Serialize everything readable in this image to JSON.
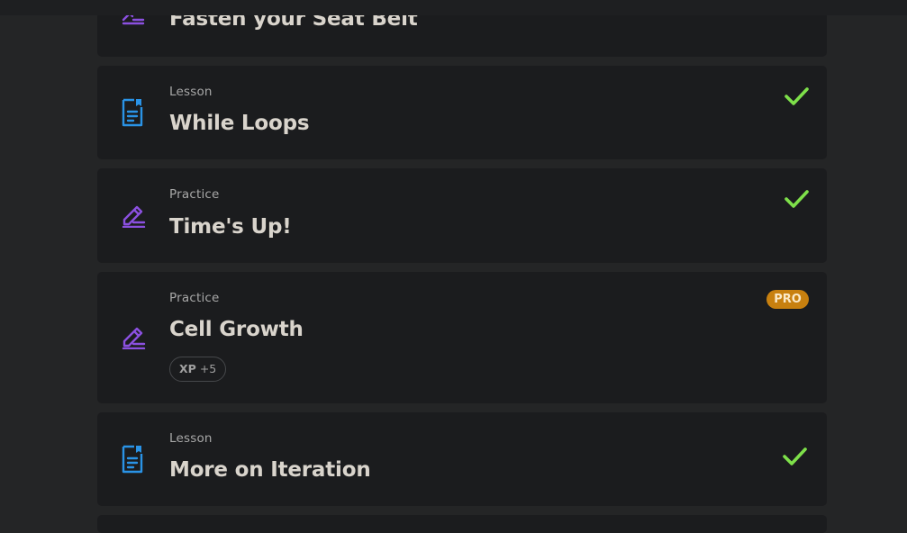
{
  "colors": {
    "lesson_icon": "#2a93e6",
    "practice_icon": "#8b50e0",
    "check": "#7ee04a",
    "pro_badge": "#c8800f"
  },
  "items": [
    {
      "type": "",
      "title": "Fasten your Seat Belt",
      "icon": "practice-icon",
      "completed": false
    },
    {
      "type": "Lesson",
      "title": "While Loops",
      "icon": "lesson-icon",
      "completed": true
    },
    {
      "type": "Practice",
      "title": "Time's Up!",
      "icon": "practice-icon",
      "completed": true
    },
    {
      "type": "Practice",
      "title": "Cell Growth",
      "icon": "practice-icon",
      "completed": false,
      "badge": "PRO",
      "xp_label": "XP",
      "xp_value": "+5"
    },
    {
      "type": "Lesson",
      "title": "More on Iteration",
      "icon": "lesson-icon",
      "completed": true
    }
  ]
}
